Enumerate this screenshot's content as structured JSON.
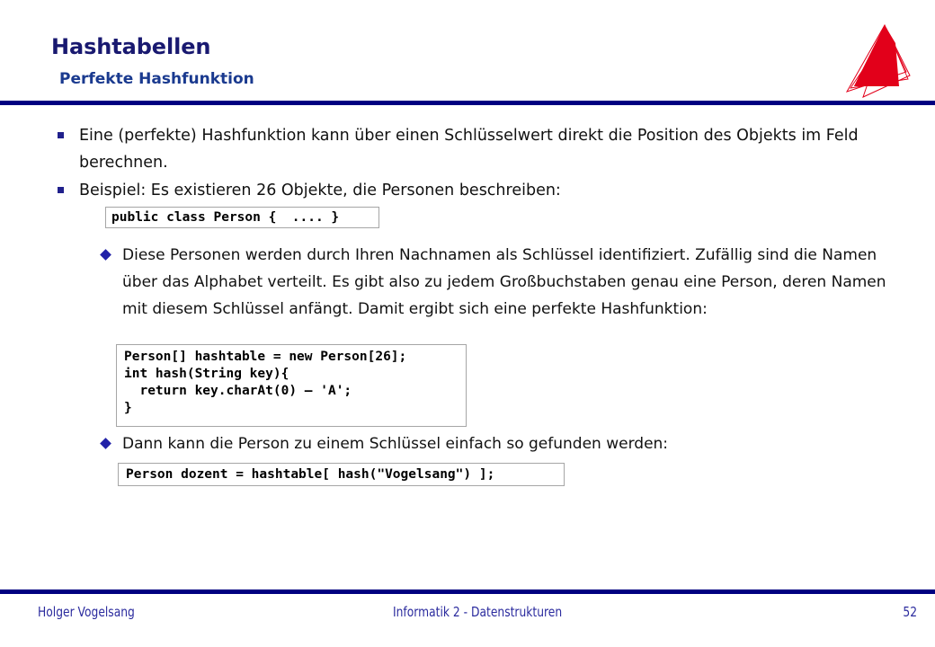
{
  "slide": {
    "title": "Hashtabellen",
    "subtitle": "Perfekte Hashfunktion",
    "logo_name": "hochschule-pyramid-logo",
    "accent_color": "#000080",
    "title_color": "#191970",
    "logo_color": "#e2001a"
  },
  "body": {
    "bullets": [
      {
        "level": 1,
        "marker": "square-bullet",
        "text": "Eine (perfekte) Hashfunktion kann über einen Schlüsselwert direkt die Position des Objekts im Feld berechnen."
      },
      {
        "level": 1,
        "marker": "square-bullet",
        "text": "Beispiel: Es existieren 26 Objekte, die Personen beschreiben:"
      },
      {
        "level": 2,
        "marker": "diamond-bullet",
        "text": "Diese Personen werden durch Ihren Nachnamen als Schlüssel identifiziert. Zufällig sind die Namen über das Alphabet verteilt. Es gibt also zu jedem Großbuchstaben genau eine Person, deren Namen mit diesem Schlüssel anfängt. Damit ergibt sich eine perfekte Hashfunktion:"
      },
      {
        "level": 2,
        "marker": "diamond-bullet",
        "text": "Dann kann die Person zu einem Schlüssel einfach so gefunden werden:"
      }
    ],
    "code_blocks": [
      {
        "id": "code-person-class",
        "code": "public class Person {  .... }"
      },
      {
        "id": "code-hashtable-hash",
        "code": "Person[] hashtable = new Person[26];\nint hash(String key){\n  return key.charAt(0) – 'A';\n}"
      },
      {
        "id": "code-lookup-dozent",
        "code": "Person dozent = hashtable[ hash(\"Vogelsang\") ];"
      }
    ]
  },
  "footer": {
    "author": "Holger Vogelsang",
    "course": "Informatik 2 - Datenstrukturen",
    "page_number": "52"
  }
}
